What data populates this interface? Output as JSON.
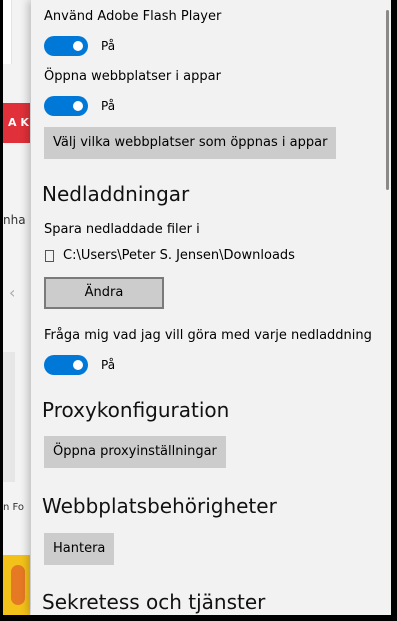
{
  "background_page": {
    "banner_text": "A K",
    "text_1": "nha",
    "text_2": "n Fo"
  },
  "settings": {
    "flash": {
      "label": "Använd Adobe Flash Player",
      "state": "På"
    },
    "open_in_apps": {
      "label": "Öppna webbplatser i appar",
      "state": "På"
    },
    "choose_sites_button": "Välj vilka webbplatser som öppnas i appar",
    "downloads": {
      "heading": "Nedladdningar",
      "save_label": "Spara nedladdade filer i",
      "path": "C:\\Users\\Peter S. Jensen\\Downloads",
      "change_button": "Ändra",
      "ask_label": "Fråga mig vad jag vill göra med varje nedladdning",
      "ask_state": "På"
    },
    "proxy": {
      "heading": "Proxykonfiguration",
      "button": "Öppna proxyinställningar"
    },
    "permissions": {
      "heading": "Webbplatsbehörigheter",
      "button": "Hantera"
    },
    "privacy": {
      "heading": "Sekretess och tjänster"
    }
  },
  "colors": {
    "accent": "#0078d7",
    "button_bg": "#cccccc",
    "panel_bg": "#f2f2f2"
  }
}
